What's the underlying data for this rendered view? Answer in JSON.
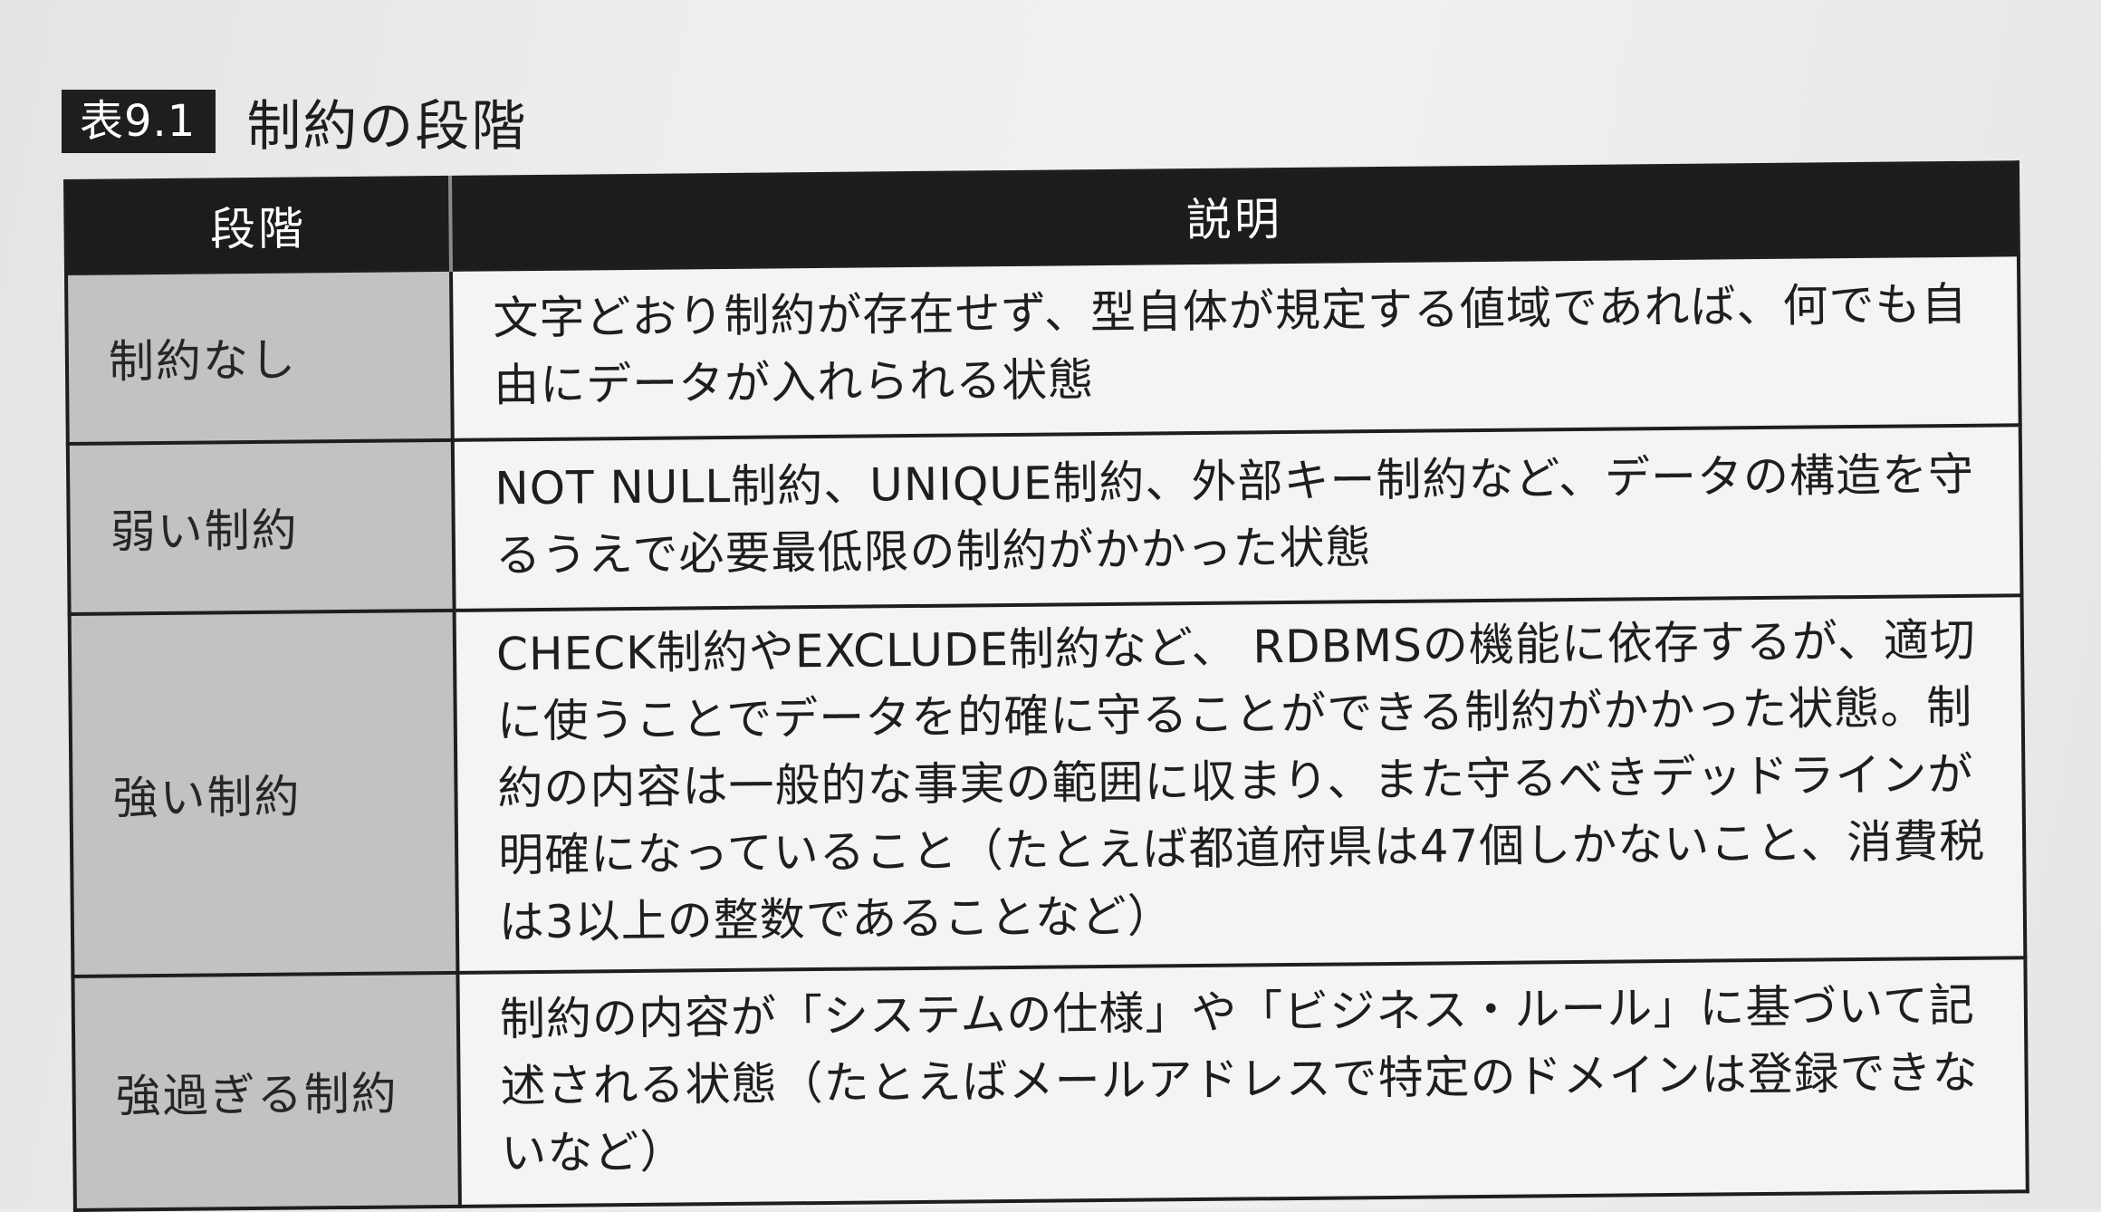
{
  "caption": {
    "number": "表9.1",
    "title": "制約の段階"
  },
  "table": {
    "headers": {
      "stage": "段階",
      "description": "説明"
    },
    "rows": [
      {
        "stage": "制約なし",
        "description": "文字どおり制約が存在せず、型自体が規定する値域であれば、何でも自由にデータが入れられる状態"
      },
      {
        "stage": "弱い制約",
        "description": "NOT NULL制約、UNIQUE制約、外部キー制約など、データの構造を守るうえで必要最低限の制約がかかった状態"
      },
      {
        "stage": "強い制約",
        "description": "CHECK制約やEXCLUDE制約など、 RDBMSの機能に依存するが、適切に使うことでデータを的確に守ることができる制約がかかった状態。制約の内容は一般的な事実の範囲に収まり、また守るべきデッドラインが明確になっていること（たとえば都道府県は47個しかないこと、消費税は3以上の整数であることなど）"
      },
      {
        "stage": "強過ぎる制約",
        "description": "制約の内容が「システムの仕様」や「ビジネス・ルール」に基づいて記述される状態（たとえばメールアドレスで特定のドメインは登録できないなど）"
      }
    ]
  }
}
